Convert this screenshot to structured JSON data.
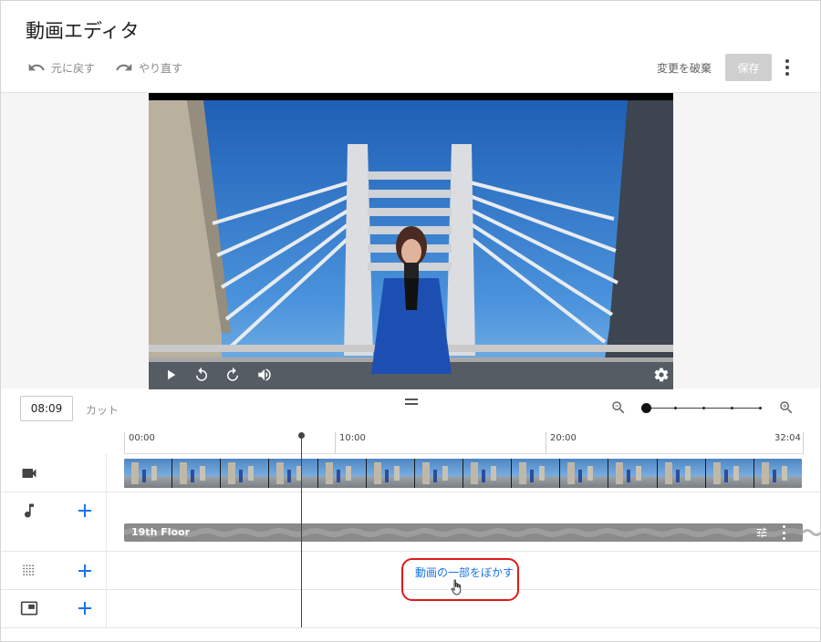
{
  "header": {
    "title": "動画エディタ",
    "undo_label": "元に戻す",
    "redo_label": "やり直す",
    "discard_label": "変更を破棄",
    "save_label": "保存"
  },
  "timeline": {
    "current_time": "08:09",
    "cut_label": "カット",
    "zoom_level": 0,
    "ruler_labels": [
      "00:00",
      "10:00",
      "20:00",
      "32:04"
    ],
    "audio_track_title": "19th Floor",
    "blur_action_label": "動画の一部をぼかす"
  },
  "icons": {
    "undo": "undo-icon",
    "redo": "redo-icon",
    "more": "more-vert-icon",
    "play": "play-icon",
    "rewind": "rewind-10-icon",
    "forward": "forward-10-icon",
    "volume": "volume-icon",
    "settings": "gear-icon",
    "zoom_out": "zoom-out-icon",
    "zoom_in": "zoom-in-icon",
    "video_track": "video-camera-icon",
    "audio_track": "music-note-icon",
    "blur_track": "blur-grid-icon",
    "endscreen_track": "end-screen-icon"
  },
  "colors": {
    "accent": "#1a73e8",
    "save_disabled": "#cfcfcf",
    "highlight_outline": "#e01919"
  }
}
